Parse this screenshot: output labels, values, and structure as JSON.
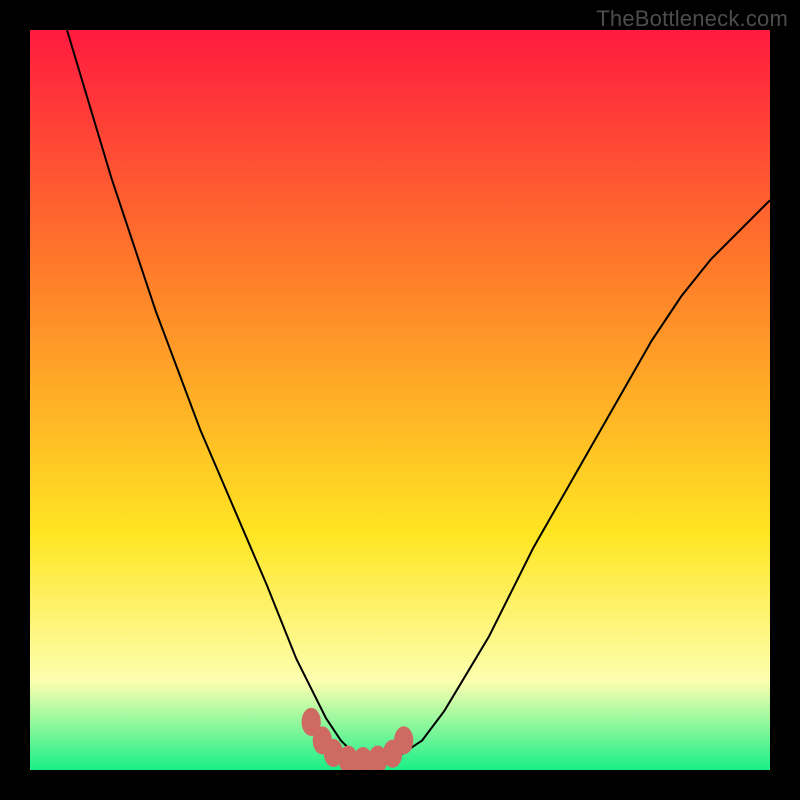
{
  "watermark": "TheBottleneck.com",
  "colors": {
    "frame": "#000000",
    "gradient_top": "#ff1a3f",
    "gradient_mid_upper": "#ff7a2a",
    "gradient_mid": "#ffe522",
    "gradient_pale": "#fdffb0",
    "gradient_bottom": "#19ef87",
    "curve": "#000000",
    "marker_fill": "#cf6a63",
    "marker_stroke": "#cf6a63"
  },
  "chart_data": {
    "type": "line",
    "title": "",
    "xlabel": "",
    "ylabel": "",
    "xlim": [
      0,
      100
    ],
    "ylim": [
      0,
      100
    ],
    "grid": false,
    "legend": false,
    "series": [
      {
        "name": "bottleneck-curve",
        "x": [
          5,
          8,
          11,
          14,
          17,
          20,
          23,
          26,
          29,
          32,
          34,
          36,
          38,
          40,
          42,
          44,
          46,
          48,
          50,
          53,
          56,
          59,
          62,
          65,
          68,
          72,
          76,
          80,
          84,
          88,
          92,
          96,
          100
        ],
        "y": [
          100,
          90,
          80,
          71,
          62,
          54,
          46,
          39,
          32,
          25,
          20,
          15,
          11,
          7,
          4,
          2,
          1,
          1,
          2,
          4,
          8,
          13,
          18,
          24,
          30,
          37,
          44,
          51,
          58,
          64,
          69,
          73,
          77
        ]
      }
    ],
    "markers": {
      "name": "highlight-points",
      "x": [
        38,
        39.5,
        41,
        43,
        45,
        47,
        49,
        50.5
      ],
      "y": [
        6.5,
        4,
        2.3,
        1.4,
        1.2,
        1.4,
        2.2,
        4
      ]
    }
  }
}
